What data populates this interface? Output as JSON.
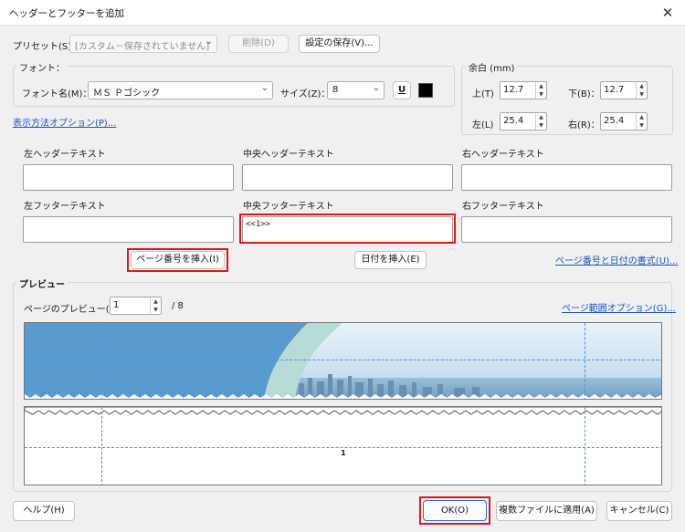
{
  "window": {
    "title": "ヘッダーとフッターを追加",
    "close_glyph": "✕"
  },
  "preset": {
    "label": "プリセット(S)：",
    "value": "[カスタム－保存されていません]",
    "delete_label": "削除(D)",
    "save_label": "設定の保存(V)..."
  },
  "font": {
    "group_label": "フォント：",
    "name_label": "フォント名(M)：",
    "name_value": "ＭＳ Ｐゴシック",
    "size_label": "サイズ(Z)：",
    "size_value": "8",
    "underline_glyph": "U",
    "color": "#000000"
  },
  "margin": {
    "group_label": "余白 (mm)",
    "top_label": "上(T)",
    "top_value": "12.7",
    "bottom_label": "下(B)：",
    "bottom_value": "12.7",
    "left_label": "左(L)",
    "left_value": "25.4",
    "right_label": "右(R)：",
    "right_value": "25.4"
  },
  "display_options_link": "表示方法オプション(P)...",
  "text_fields": {
    "left_header_label": "左ヘッダーテキスト",
    "center_header_label": "中央ヘッダーテキスト",
    "right_header_label": "右ヘッダーテキスト",
    "left_footer_label": "左フッターテキスト",
    "center_footer_label": "中央フッターテキスト",
    "center_footer_value": "<<1>>",
    "right_footer_label": "右フッターテキスト"
  },
  "insert_page_number_label": "ページ番号を挿入(I)",
  "insert_date_label": "日付を挿入(E)",
  "page_date_format_link": "ページ番号と日付の書式(U)...",
  "preview": {
    "group_label": "プレビュー",
    "page_label": "ページのプレビュー(E)",
    "page_value": "1",
    "total_pages": "/ 8",
    "page_range_link": "ページ範囲オプション(G)...",
    "page_number_shown": "1"
  },
  "footer_buttons": {
    "help": "ヘルプ(H)",
    "ok": "OK(O)",
    "apply_multiple": "複数ファイルに適用(A)",
    "cancel": "キャンセル(C)"
  },
  "colors": {
    "highlight": "#e4141c",
    "link": "#1a55c8",
    "guide": "#4a90d9"
  }
}
